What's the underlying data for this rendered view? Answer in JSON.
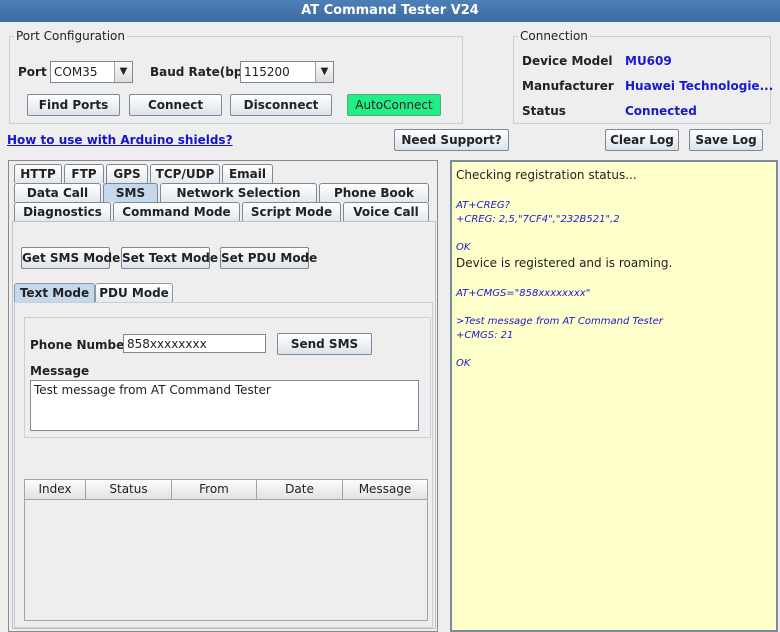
{
  "window": {
    "title": "AT Command Tester V24"
  },
  "port_config": {
    "title": "Port Configuration",
    "port_label": "Port",
    "port_value": "COM35",
    "baud_label": "Baud Rate(bps)",
    "baud_value": "115200",
    "find_ports": "Find Ports",
    "connect": "Connect",
    "disconnect": "Disconnect",
    "autoconnect": "AutoConnect"
  },
  "connection": {
    "title": "Connection",
    "model_label": "Device Model",
    "model_value": "MU609",
    "manufacturer_label": "Manufacturer",
    "manufacturer_value": "Huawei Technologie...",
    "status_label": "Status",
    "status_value": "Connected"
  },
  "links": {
    "arduino": "How to use with Arduino shields?"
  },
  "toolbar": {
    "need_support": "Need Support?",
    "clear_log": "Clear Log",
    "save_log": "Save Log"
  },
  "tabs": {
    "row1": [
      "HTTP",
      "FTP",
      "GPS",
      "TCP/UDP",
      "Email"
    ],
    "row2": [
      "Data Call",
      "SMS",
      "Network Selection",
      "Phone Book"
    ],
    "row3": [
      "Diagnostics",
      "Command Mode",
      "Script Mode",
      "Voice Call"
    ],
    "active": "SMS"
  },
  "sms": {
    "get_mode": "Get SMS Mode",
    "set_text": "Set Text Mode",
    "set_pdu": "Set PDU Mode",
    "subtabs": [
      "Text Mode",
      "PDU Mode"
    ],
    "phone_label": "Phone Number",
    "phone_value": "858xxxxxxxx",
    "send": "Send SMS",
    "message_label": "Message",
    "message_value": "Test message from AT Command Tester",
    "table_columns": [
      "Index",
      "Status",
      "From",
      "Date",
      "Message"
    ]
  },
  "log": [
    {
      "text": "Checking registration status...",
      "kind": "plain"
    },
    {
      "text": "AT+CREG?",
      "kind": "cmd"
    },
    {
      "text": "+CREG: 2,5,\"7CF4\",\"232B521\",2",
      "kind": "cmd"
    },
    {
      "text": "OK",
      "kind": "cmd"
    },
    {
      "text": "Device is registered and is roaming.",
      "kind": "plain"
    },
    {
      "text": "AT+CMGS=\"858xxxxxxxx\"",
      "kind": "cmd"
    },
    {
      "text": ">Test message from AT Command Tester",
      "kind": "cmd"
    },
    {
      "text": "+CMGS: 21",
      "kind": "cmd"
    },
    {
      "text": "OK",
      "kind": "cmd"
    }
  ]
}
